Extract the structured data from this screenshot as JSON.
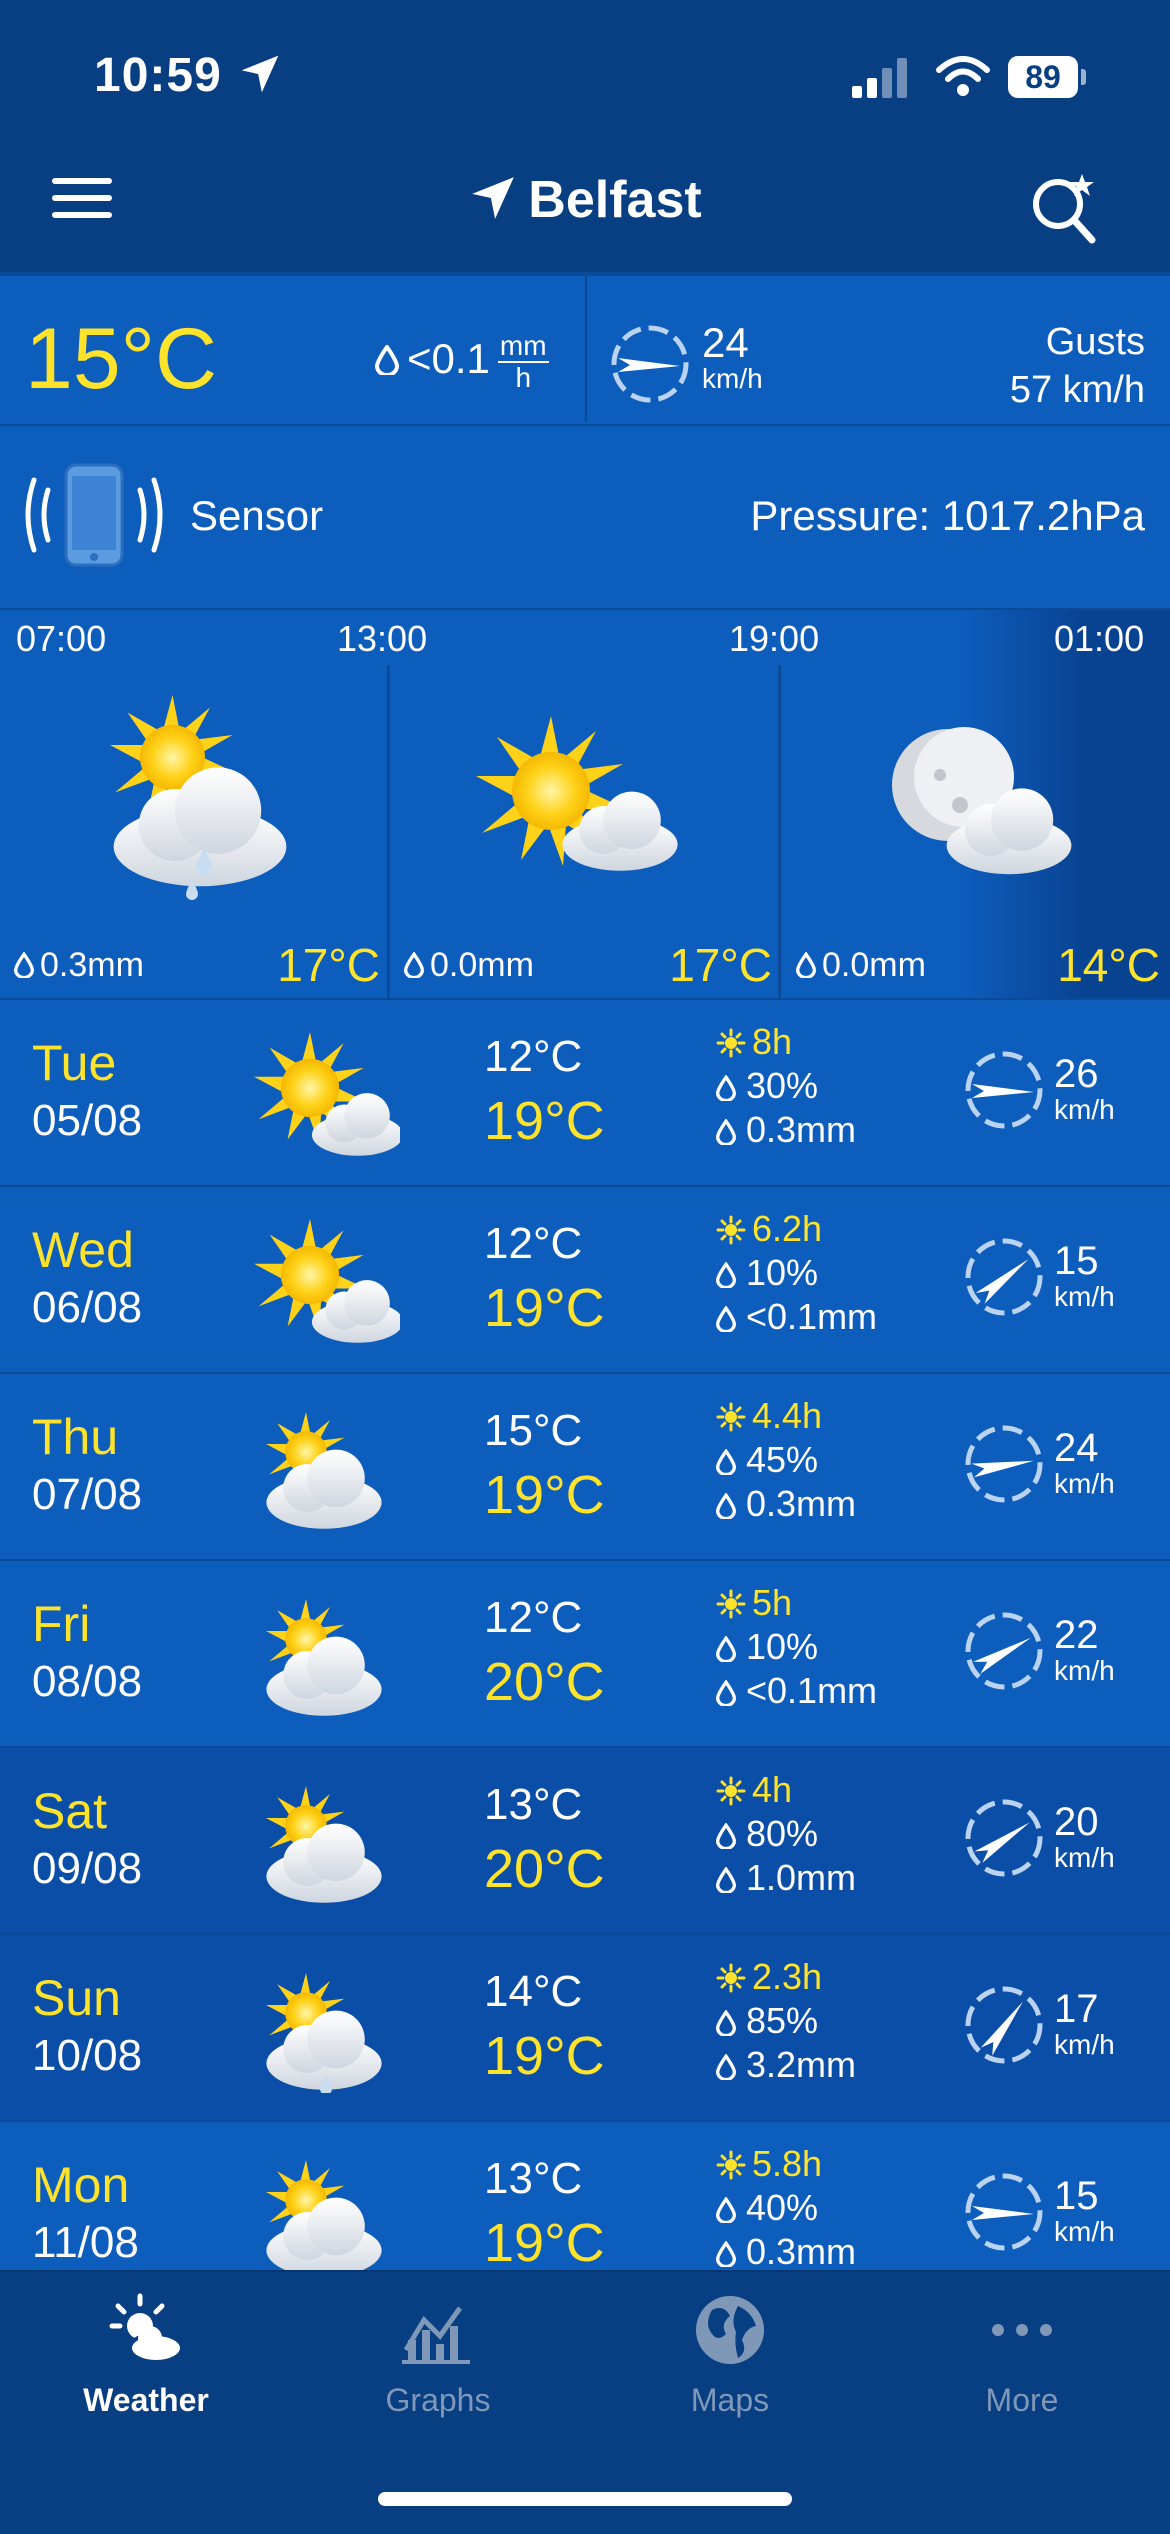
{
  "status_bar": {
    "time": "10:59",
    "battery": "89"
  },
  "header": {
    "city": "Belfast"
  },
  "current": {
    "temperature": "15°C",
    "rain_value": "<0.1",
    "rain_unit_top": "mm",
    "rain_unit_bottom": "h",
    "wind_speed": "24",
    "wind_unit": "km/h",
    "gusts_label": "Gusts",
    "gusts_value": "57 km/h",
    "sensor_label": "Sensor",
    "pressure": "Pressure: 1017.2hPa"
  },
  "hourly": [
    {
      "time": "07:00",
      "rain": "0.3mm",
      "temp": "17°C",
      "icon": "sun-cloud-rain-icon"
    },
    {
      "time": "13:00",
      "rain": "0.0mm",
      "temp": "17°C",
      "icon": "sun-cloud-icon"
    },
    {
      "time": "19:00",
      "rain": "0.0mm",
      "temp": "14°C",
      "icon": "moon-cloud-icon"
    },
    {
      "time": "01:00"
    }
  ],
  "daily": [
    {
      "day": "Tue",
      "date": "05/08",
      "tmin": "12°C",
      "tmax": "19°C",
      "sun": "8h",
      "precip_chance": "30%",
      "precip": "0.3mm",
      "wind": "26",
      "wind_unit": "km/h",
      "icon": "sun-cloud-icon"
    },
    {
      "day": "Wed",
      "date": "06/08",
      "tmin": "12°C",
      "tmax": "19°C",
      "sun": "6.2h",
      "precip_chance": "10%",
      "precip": "<0.1mm",
      "wind": "15",
      "wind_unit": "km/h",
      "icon": "sun-cloud-icon"
    },
    {
      "day": "Thu",
      "date": "07/08",
      "tmin": "15°C",
      "tmax": "19°C",
      "sun": "4.4h",
      "precip_chance": "45%",
      "precip": "0.3mm",
      "wind": "24",
      "wind_unit": "km/h",
      "icon": "cloud-sun-icon"
    },
    {
      "day": "Fri",
      "date": "08/08",
      "tmin": "12°C",
      "tmax": "20°C",
      "sun": "5h",
      "precip_chance": "10%",
      "precip": "<0.1mm",
      "wind": "22",
      "wind_unit": "km/h",
      "icon": "cloud-sun-icon"
    },
    {
      "day": "Sat",
      "date": "09/08",
      "tmin": "13°C",
      "tmax": "20°C",
      "sun": "4h",
      "precip_chance": "80%",
      "precip": "1.0mm",
      "wind": "20",
      "wind_unit": "km/h",
      "icon": "cloud-sun-icon"
    },
    {
      "day": "Sun",
      "date": "10/08",
      "tmin": "14°C",
      "tmax": "19°C",
      "sun": "2.3h",
      "precip_chance": "85%",
      "precip": "3.2mm",
      "wind": "17",
      "wind_unit": "km/h",
      "icon": "cloud-sun-rain-icon"
    },
    {
      "day": "Mon",
      "date": "11/08",
      "tmin": "13°C",
      "tmax": "19°C",
      "sun": "5.8h",
      "precip_chance": "40%",
      "precip": "0.3mm",
      "wind": "15",
      "wind_unit": "km/h",
      "icon": "cloud-sun-icon"
    }
  ],
  "tabs": [
    {
      "label": "Weather",
      "active": true
    },
    {
      "label": "Graphs"
    },
    {
      "label": "Maps"
    },
    {
      "label": "More"
    }
  ],
  "colors": {
    "accent_yellow": "#ffe22a",
    "panel_blue": "#0d5dbd",
    "dark_blue": "#073f82"
  }
}
